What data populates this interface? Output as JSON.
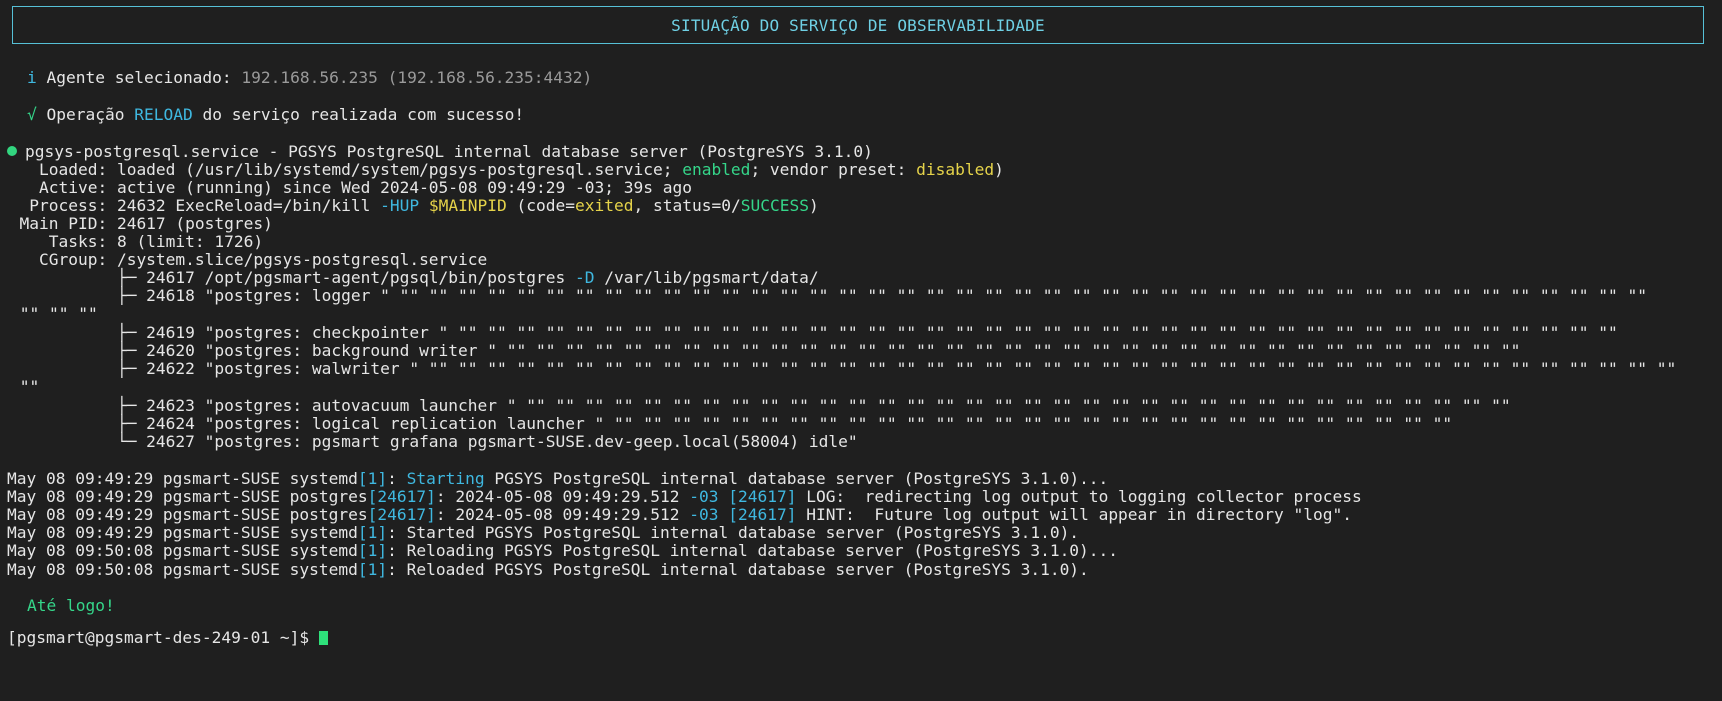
{
  "header": {
    "title": "SITUAÇÃO DO SERVIÇO DE OBSERVABILIDADE"
  },
  "info": {
    "icon": "i",
    "label": "Agente selecionado:",
    "value": "192.168.56.235 (192.168.56.235:4432)"
  },
  "success": {
    "icon": "√",
    "prefix": "Operação",
    "op": "RELOAD",
    "suffix": "do serviço realizada com sucesso!"
  },
  "service": {
    "title": "pgsys-postgresql.service - PGSYS PostgreSQL internal database server (PostgreSYS 3.1.0)",
    "loaded_a": "    Loaded: loaded (/usr/lib/systemd/system/pgsys-postgresql.service; ",
    "loaded_enabled": "enabled",
    "loaded_b": "; vendor preset: ",
    "loaded_disabled": "disabled",
    "loaded_c": ")",
    "active": "    Active: active (running) since Wed 2024-05-08 09:49:29 -03; 39s ago",
    "process_a": "   Process: 24632 ExecReload=/bin/kill ",
    "process_hup": "-HUP",
    "process_b": " ",
    "process_mainpid": "$MAINPID",
    "process_c": " (code=",
    "process_exited": "exited",
    "process_d": ", status=0/",
    "process_success": "SUCCESS",
    "process_e": ")",
    "mainpid": "  Main PID: 24617 (postgres)",
    "tasks": "     Tasks: 8 (limit: 1726)",
    "cgroup": "    CGroup: /system.slice/pgsys-postgresql.service"
  },
  "tree": {
    "l1a": "            ├─ 24617 /opt/pgsmart-agent/pgsql/bin/postgres ",
    "l1b": "-D",
    "l1c": " /var/lib/pgsmart/data/",
    "l2": "            ├─ 24618 \"postgres: logger \" \"\" \"\" \"\" \"\" \"\" \"\" \"\" \"\" \"\" \"\" \"\" \"\" \"\" \"\" \"\" \"\" \"\" \"\" \"\" \"\" \"\" \"\" \"\" \"\" \"\" \"\" \"\" \"\" \"\" \"\" \"\" \"\" \"\" \"\" \"\" \"\" \"\" \"\" \"\" \"\" \"\" \"\" \"\"",
    "l2b": " \"\" \"\" \"\"",
    "l3": "            ├─ 24619 \"postgres: checkpointer \" \"\" \"\" \"\" \"\" \"\" \"\" \"\" \"\" \"\" \"\" \"\" \"\" \"\" \"\" \"\" \"\" \"\" \"\" \"\" \"\" \"\" \"\" \"\" \"\" \"\" \"\" \"\" \"\" \"\" \"\" \"\" \"\" \"\" \"\" \"\" \"\" \"\" \"\" \"\" \"\"",
    "l4": "            ├─ 24620 \"postgres: background writer \" \"\" \"\" \"\" \"\" \"\" \"\" \"\" \"\" \"\" \"\" \"\" \"\" \"\" \"\" \"\" \"\" \"\" \"\" \"\" \"\" \"\" \"\" \"\" \"\" \"\" \"\" \"\" \"\" \"\" \"\" \"\" \"\" \"\" \"\" \"\"",
    "l5": "            ├─ 24622 \"postgres: walwriter \" \"\" \"\" \"\" \"\" \"\" \"\" \"\" \"\" \"\" \"\" \"\" \"\" \"\" \"\" \"\" \"\" \"\" \"\" \"\" \"\" \"\" \"\" \"\" \"\" \"\" \"\" \"\" \"\" \"\" \"\" \"\" \"\" \"\" \"\" \"\" \"\" \"\" \"\" \"\" \"\" \"\" \"\" \"\"",
    "l5b": " \"\"",
    "l6": "            ├─ 24623 \"postgres: autovacuum launcher \" \"\" \"\" \"\" \"\" \"\" \"\" \"\" \"\" \"\" \"\" \"\" \"\" \"\" \"\" \"\" \"\" \"\" \"\" \"\" \"\" \"\" \"\" \"\" \"\" \"\" \"\" \"\" \"\" \"\" \"\" \"\" \"\" \"\" \"\"",
    "l7": "            ├─ 24624 \"postgres: logical replication launcher \" \"\" \"\" \"\" \"\" \"\" \"\" \"\" \"\" \"\" \"\" \"\" \"\" \"\" \"\" \"\" \"\" \"\" \"\" \"\" \"\" \"\" \"\" \"\" \"\" \"\" \"\" \"\" \"\" \"\"",
    "l8": "            └─ 24627 \"postgres: pgsmart grafana pgsmart-SUSE.dev-geep.local(58004) idle\""
  },
  "logs": [
    {
      "a": "May 08 09:49:29 pgsmart-SUSE systemd",
      "pid": "[1]",
      "b": ": ",
      "hl": "Starting",
      "c": " PGSYS PostgreSQL internal database server (PostgreSYS 3.1.0)..."
    },
    {
      "a": "May 08 09:49:29 pgsmart-SUSE postgres",
      "pid": "[24617]",
      "b": ": 2024-05-08 09:49:29.512 ",
      "hl": "-03",
      "c": " ",
      "pid2": "[24617]",
      "d": " LOG:  redirecting log output to logging collector process"
    },
    {
      "a": "May 08 09:49:29 pgsmart-SUSE postgres",
      "pid": "[24617]",
      "b": ": 2024-05-08 09:49:29.512 ",
      "hl": "-03",
      "c": " ",
      "pid2": "[24617]",
      "d": " HINT:  Future log output will appear in directory \"log\"."
    },
    {
      "a": "May 08 09:49:29 pgsmart-SUSE systemd",
      "pid": "[1]",
      "b": ": Started PGSYS PostgreSQL internal database server (PostgreSYS 3.1.0)."
    },
    {
      "a": "May 08 09:50:08 pgsmart-SUSE systemd",
      "pid": "[1]",
      "b": ": Reloading PGSYS PostgreSQL internal database server (PostgreSYS 3.1.0)..."
    },
    {
      "a": "May 08 09:50:08 pgsmart-SUSE systemd",
      "pid": "[1]",
      "b": ": Reloaded PGSYS PostgreSQL internal database server (PostgreSYS 3.1.0)."
    }
  ],
  "goodbye": "Até logo!",
  "prompt": "[pgsmart@pgsmart-des-249-01 ~]$ ",
  "colors": {
    "accent_cyan": "#3fb8e0",
    "success_green": "#35d68a",
    "warning_yellow": "#e5d34a",
    "background": "#1f1f1f"
  }
}
